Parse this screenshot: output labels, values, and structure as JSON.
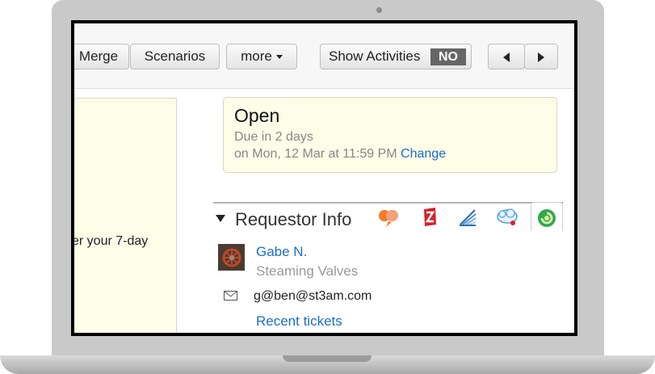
{
  "toolbar": {
    "merge_label": "Merge",
    "scenarios_label": "Scenarios",
    "more_label": "more",
    "show_activities_label": "Show Activities",
    "show_activities_value": "NO"
  },
  "left_panel": {
    "text": "er your 7-day"
  },
  "status": {
    "title": "Open",
    "due": "Due in 2 days",
    "date_prefix": "on Mon, 12 Mar at 11:59 PM",
    "change_label": "Change"
  },
  "requestor": {
    "heading": "Requestor Info",
    "name": "Gabe N.",
    "company": "Steaming Valves",
    "email": "g@ben@st3am.com",
    "recent_label": "Recent tickets"
  },
  "apps": {
    "icons": [
      "grasshopper-app-icon",
      "zendesk-app-icon",
      "feed-app-icon",
      "salesforce-app-icon",
      "green-app-icon"
    ]
  },
  "colors": {
    "link": "#1a6fc8",
    "note_bg": "#fdfde8",
    "toggle_bg": "#666666"
  }
}
